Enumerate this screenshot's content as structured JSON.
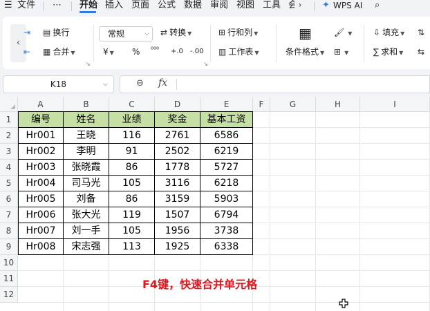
{
  "menu": {
    "hamburger_icon": "menu-icon",
    "file": "文件",
    "more": "⋯",
    "tabs": [
      "开始",
      "插入",
      "页面",
      "公式",
      "数据",
      "审阅",
      "视图",
      "工具",
      "会"
    ],
    "active_tab": "开始",
    "scroll_right": "›",
    "wps_ai": "WPS AI",
    "search_icon": "search-icon"
  },
  "ribbon": {
    "wrap_text": "换行",
    "merge": "合并",
    "number_format": "常规",
    "convert": "转换",
    "rows_cols": "行和列",
    "worksheet": "工作表",
    "conditional_format": "条件格式",
    "fill": "填充",
    "sum": "求和",
    "currency": "¥",
    "percent": "%",
    "thousands": "⁰⁰⁰",
    "inc_decimal": "+.0",
    "dec_decimal": "-.00"
  },
  "formula_bar": {
    "cell_ref": "K18",
    "fx": "fx",
    "value": ""
  },
  "sheet": {
    "columns": [
      "A",
      "B",
      "C",
      "D",
      "E",
      "F",
      "G",
      "H",
      "I"
    ],
    "rows": [
      "1",
      "2",
      "3",
      "4",
      "5",
      "6",
      "7",
      "8",
      "9",
      "10",
      "11",
      "12"
    ],
    "header": [
      "编号",
      "姓名",
      "业绩",
      "奖金",
      "基本工资"
    ],
    "records": [
      [
        "Hr001",
        "王晓",
        "116",
        "2761",
        "6586"
      ],
      [
        "Hr002",
        "李明",
        "91",
        "2502",
        "6219"
      ],
      [
        "Hr003",
        "张晓霞",
        "86",
        "1778",
        "5727"
      ],
      [
        "Hr004",
        "司马光",
        "105",
        "3116",
        "6218"
      ],
      [
        "Hr005",
        "刘备",
        "86",
        "3159",
        "5903"
      ],
      [
        "Hr006",
        "张大光",
        "119",
        "1507",
        "6794"
      ],
      [
        "Hr007",
        "刘一手",
        "105",
        "1956",
        "3738"
      ],
      [
        "Hr008",
        "宋志强",
        "113",
        "1925",
        "6338"
      ]
    ],
    "header_fill": "#c6dfa4"
  },
  "annotation": {
    "text": "F4键，快速合并单元格",
    "color": "#e4141c"
  }
}
